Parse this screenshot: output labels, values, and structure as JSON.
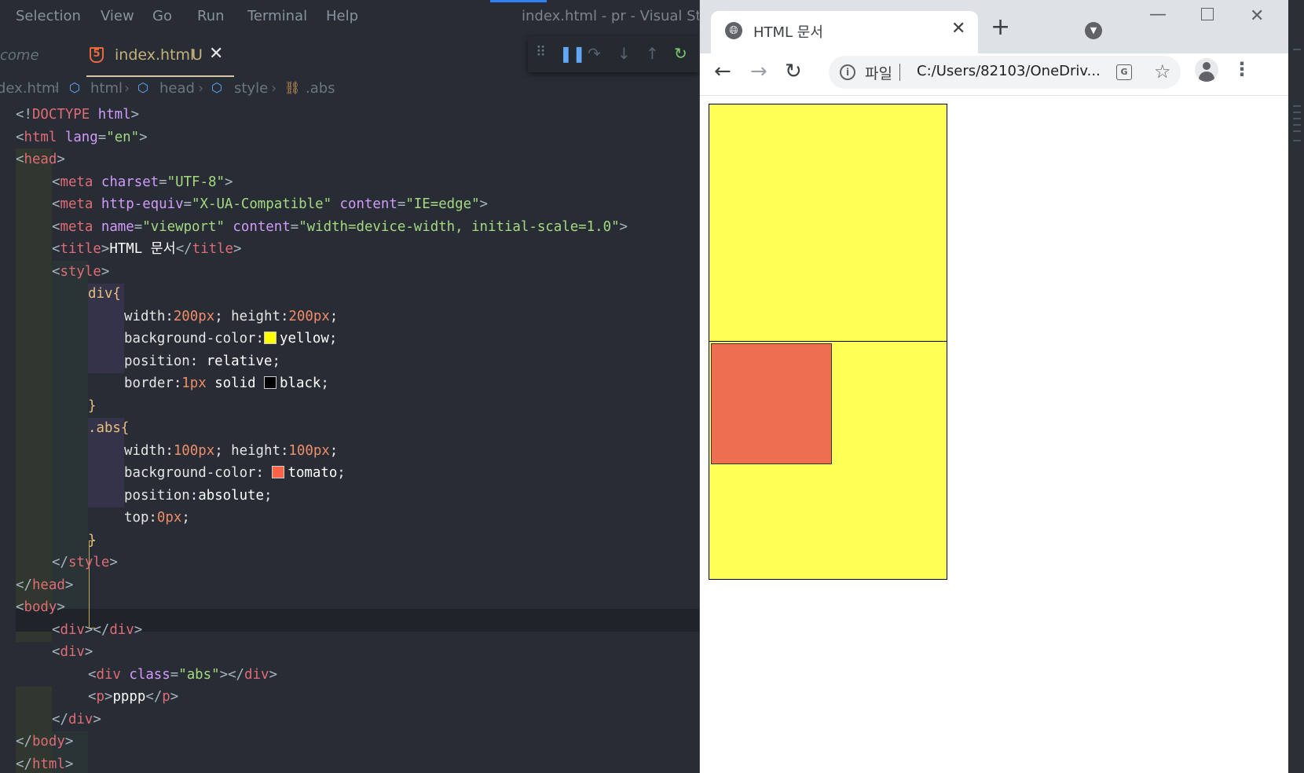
{
  "vscode": {
    "menu": [
      "Selection",
      "View",
      "Go",
      "Run",
      "Terminal",
      "Help"
    ],
    "window_title": "index.html - pr - Visual Studi",
    "tabs": {
      "left_partial": "come",
      "active_name": "index.html",
      "active_status": "U",
      "close_glyph": "✕"
    },
    "breadcrumb": [
      "dex.html",
      "html",
      "head",
      "style",
      ".abs"
    ],
    "code_lines": [
      "<!DOCTYPE html>",
      "<html lang=\"en\">",
      "<head>",
      "<meta charset=\"UTF-8\">",
      "<meta http-equiv=\"X-UA-Compatible\" content=\"IE=edge\">",
      "<meta name=\"viewport\" content=\"width=device-width, initial-scale=1.0\">",
      "<title>HTML 문서</title>",
      "<style>",
      "div{",
      "width:200px; height:200px;",
      "background-color: yellow;",
      "position: relative;",
      "border:1px solid  black;",
      "}",
      ".abs{",
      "width:100px; height:100px;",
      "background-color:  tomato;",
      "position:absolute;",
      "top:0px;",
      "}",
      "</style>",
      "</head>",
      "<body>",
      "<div></div>",
      "<div>",
      "<div class=\"abs\"></div>",
      "<p>pppp</p>",
      "</div>",
      "</body>",
      "</html>"
    ],
    "swatch_colors": {
      "yellow": "#ffff00",
      "tomato": "#ff6347",
      "black": "#000000"
    }
  },
  "browser": {
    "tab_title": "HTML 문서",
    "new_tab": "+",
    "scheme_label": "파일",
    "url": "C:/Users/82103/OneDriv...",
    "page": {
      "box_color": "#ffff55",
      "abs_color": "#ed6e51",
      "border_color": "#000000"
    }
  }
}
